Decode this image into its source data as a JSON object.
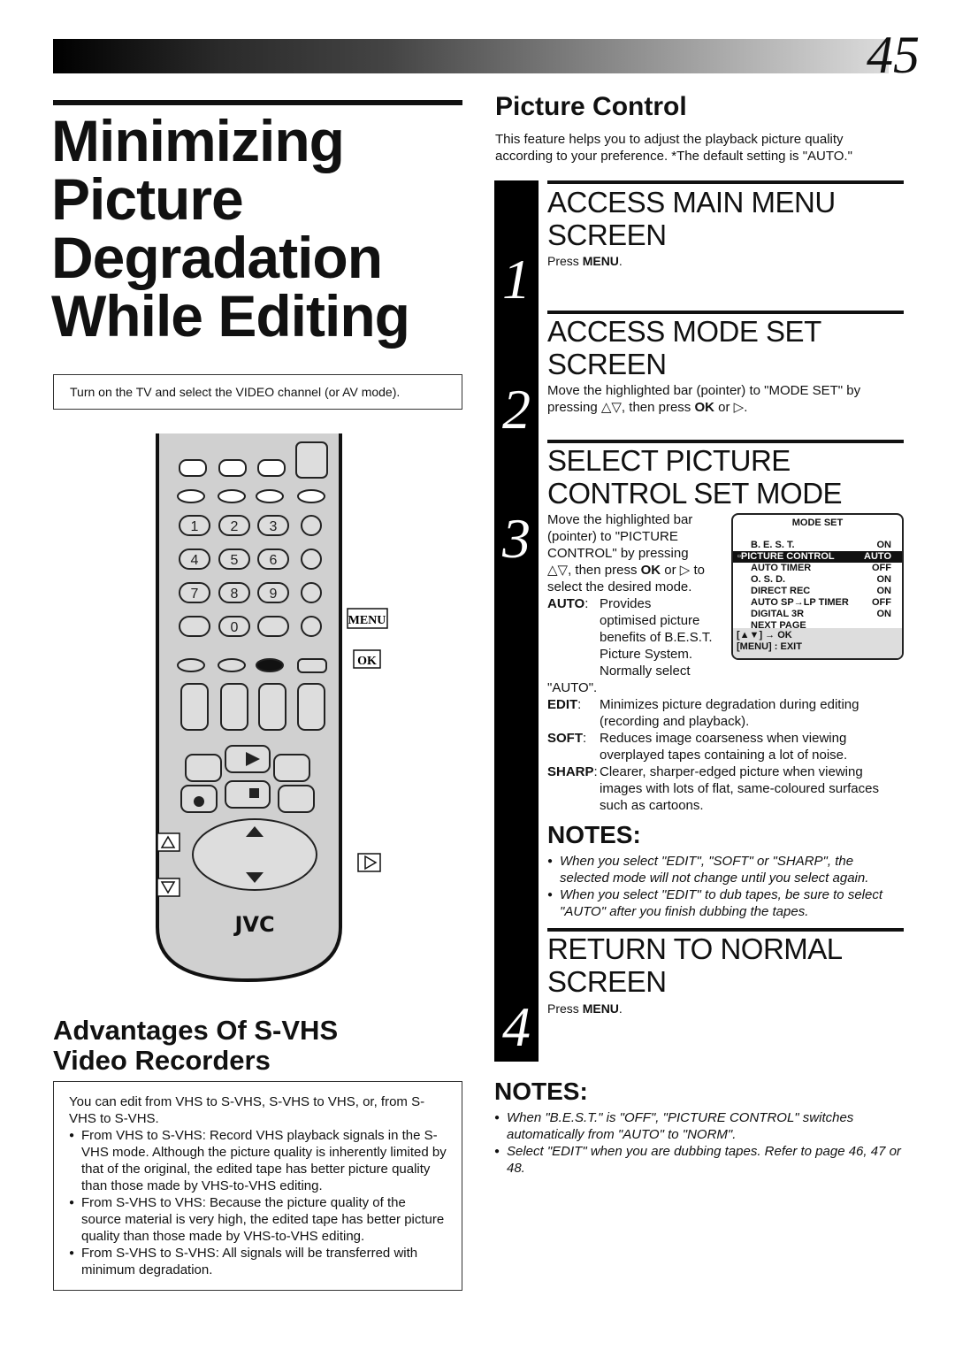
{
  "page_number": "45",
  "title": [
    "Minimizing",
    "Picture",
    "Degradation",
    "While Editing"
  ],
  "tv_note": "Turn on the TV and select the VIDEO channel (or AV mode).",
  "remote": {
    "menu_label": "MENU",
    "ok_label": "OK",
    "brand": "JVC",
    "numbers": [
      "1",
      "2",
      "3",
      "4",
      "5",
      "6",
      "7",
      "8",
      "9",
      "0"
    ]
  },
  "advantages": {
    "title": [
      "Advantages Of S-VHS",
      "Video Recorders"
    ],
    "intro": "You can edit from VHS to S-VHS, S-VHS to VHS, or, from S-VHS to S-VHS.",
    "items": [
      "From VHS to S-VHS: Record VHS playback signals in the S-VHS mode. Although the picture quality is inherently limited by that of the original, the edited tape has better picture quality than those made by VHS-to-VHS editing.",
      "From S-VHS to VHS: Because the picture quality of the source material is very high, the edited tape has better picture quality than those made by VHS-to-VHS editing.",
      "From S-VHS to S-VHS: All signals will be transferred with minimum degradation."
    ]
  },
  "picture_control": {
    "title": "Picture Control",
    "intro": "This feature helps you to adjust the playback picture quality according to your preference. *The default setting is \"AUTO.\""
  },
  "steps": [
    {
      "num": "1",
      "heading": [
        "ACCESS MAIN MENU",
        "SCREEN"
      ],
      "pre": "Press ",
      "key": "MENU",
      "post": "."
    },
    {
      "num": "2",
      "heading": [
        "ACCESS MODE SET",
        "SCREEN"
      ],
      "text": "Move the highlighted bar (pointer) to \"MODE SET\" by pressing △▽, then press ",
      "key": "OK",
      "post": " or ▷."
    },
    {
      "num": "3",
      "heading": [
        "SELECT PICTURE",
        "CONTROL SET MODE"
      ],
      "text_lines": [
        "Move the highlighted bar",
        "(pointer) to \"PICTURE",
        "CONTROL\" by pressing"
      ],
      "line4_pre": "△▽, then press ",
      "line4_key": "OK",
      "line4_post": " or ▷ to",
      "line5": "select the desired mode.",
      "modes": [
        {
          "key": "AUTO",
          "sep": ":",
          "lines": [
            "Provides",
            "optimised picture",
            "benefits of B.E.S.T.",
            "Picture System.",
            "Normally select",
            "\"AUTO\"."
          ]
        },
        {
          "key": "EDIT",
          "sep": ":",
          "lines": [
            "Minimizes picture degradation during editing",
            "(recording and playback)."
          ]
        },
        {
          "key": "SOFT",
          "sep": ":",
          "lines": [
            "Reduces image coarseness when viewing",
            "overplayed tapes containing a lot of noise."
          ]
        },
        {
          "key": "SHARP",
          "sep": ":",
          "lines": [
            "Clearer, sharper-edged picture when viewing",
            "images with lots of flat, same-coloured surfaces",
            "such as cartoons."
          ]
        }
      ]
    },
    {
      "num": "4",
      "heading": [
        "RETURN TO NORMAL",
        "SCREEN"
      ],
      "pre": "Press ",
      "key": "MENU",
      "post": "."
    }
  ],
  "osd": {
    "title": "MODE SET",
    "rows": [
      {
        "label": "B. E. S. T.",
        "value": "ON"
      },
      {
        "label": "PICTURE CONTROL",
        "value": "AUTO",
        "highlighted": true
      },
      {
        "label": "AUTO TIMER",
        "value": "OFF"
      },
      {
        "label": "O. S. D.",
        "value": "ON"
      },
      {
        "label": "DIRECT REC",
        "value": "ON"
      },
      {
        "label": "AUTO SP→LP TIMER",
        "value": "OFF"
      },
      {
        "label": "DIGITAL 3R",
        "value": "ON"
      },
      {
        "label": "NEXT PAGE",
        "value": ""
      }
    ],
    "footer": [
      "[▲▼] → OK",
      "[MENU] : EXIT"
    ]
  },
  "notes1": {
    "title": "NOTES:",
    "items": [
      "When you select \"EDIT\", \"SOFT\" or \"SHARP\", the selected mode will not change until you select again.",
      "When you select \"EDIT\" to dub tapes, be sure to select \"AUTO\" after you finish dubbing the tapes."
    ]
  },
  "notes2": {
    "title": "NOTES:",
    "items": [
      "When \"B.E.S.T.\" is \"OFF\", \"PICTURE CONTROL\" switches automatically from \"AUTO\" to \"NORM\".",
      "Select \"EDIT\" when you are dubbing tapes. Refer to page 46, 47 or 48."
    ]
  }
}
